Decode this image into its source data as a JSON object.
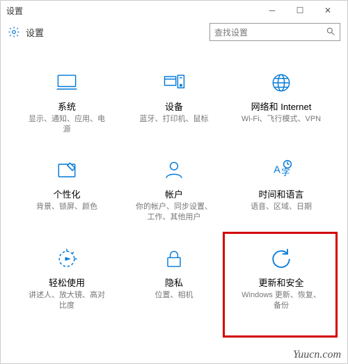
{
  "window": {
    "title": "设置"
  },
  "header": {
    "title": "设置"
  },
  "search": {
    "placeholder": "查找设置"
  },
  "tiles": [
    {
      "title": "系统",
      "desc": "显示、通知、应用、电源"
    },
    {
      "title": "设备",
      "desc": "蓝牙、打印机、鼠标"
    },
    {
      "title": "网络和 Internet",
      "desc": "Wi-Fi、飞行模式、VPN"
    },
    {
      "title": "个性化",
      "desc": "背景、锁屏、颜色"
    },
    {
      "title": "帐户",
      "desc": "你的帐户、同步设置、工作、其他用户"
    },
    {
      "title": "时间和语言",
      "desc": "语音、区域、日期"
    },
    {
      "title": "轻松使用",
      "desc": "讲述人、放大镜、高对比度"
    },
    {
      "title": "隐私",
      "desc": "位置、相机"
    },
    {
      "title": "更新和安全",
      "desc": "Windows 更新、恢复、备份"
    }
  ],
  "watermark": "Yuucn.com"
}
